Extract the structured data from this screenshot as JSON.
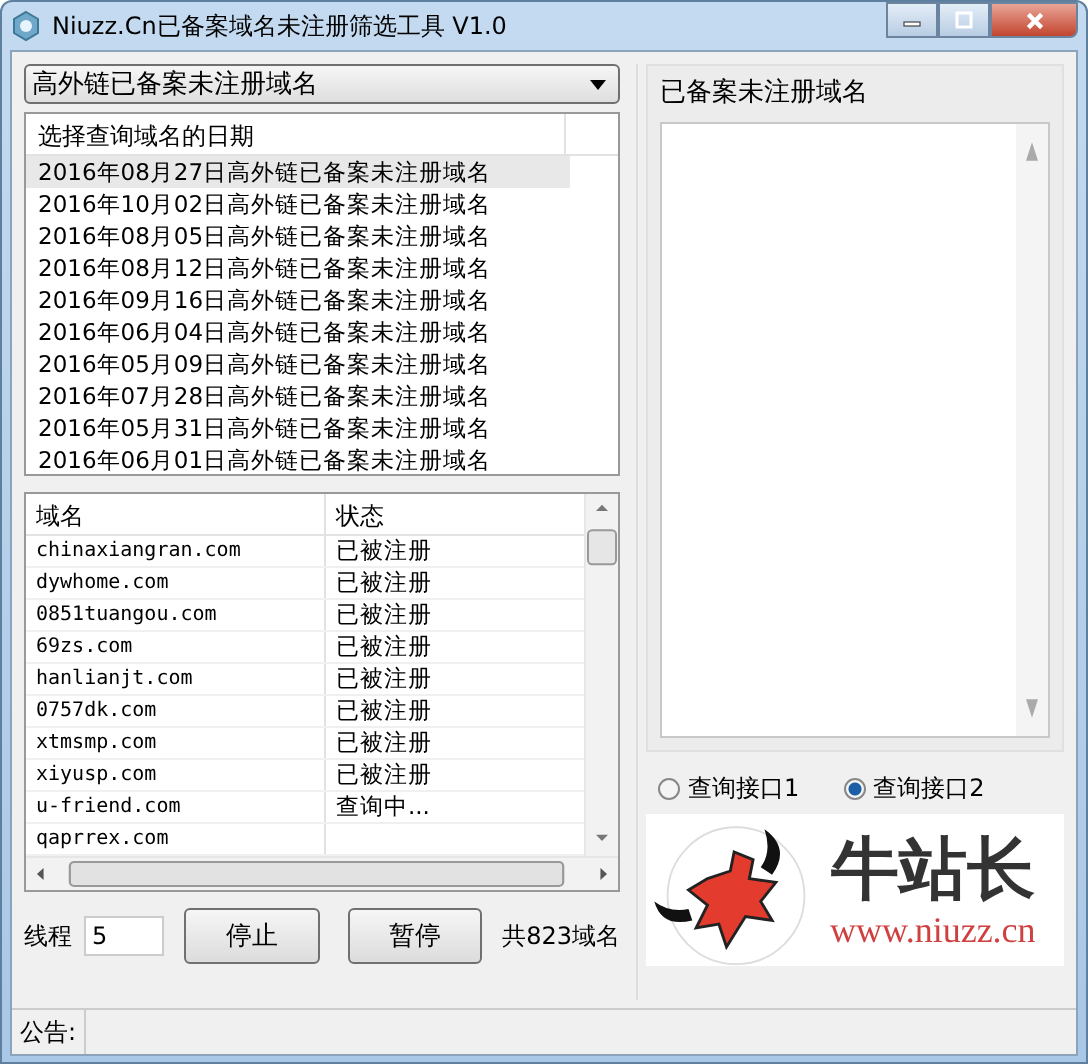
{
  "window": {
    "title": "Niuzz.Cn已备案域名未注册筛选工具 V1.0"
  },
  "category_select": {
    "value": "高外链已备案未注册域名"
  },
  "date_list": {
    "header": "选择查询域名的日期",
    "rows": [
      {
        "label": "2016年08月27日高外链已备案未注册域名",
        "selected": true
      },
      {
        "label": "2016年10月02日高外链已备案未注册域名",
        "selected": false
      },
      {
        "label": "2016年08月05日高外链已备案未注册域名",
        "selected": false
      },
      {
        "label": "2016年08月12日高外链已备案未注册域名",
        "selected": false
      },
      {
        "label": "2016年09月16日高外链已备案未注册域名",
        "selected": false
      },
      {
        "label": "2016年06月04日高外链已备案未注册域名",
        "selected": false
      },
      {
        "label": "2016年05月09日高外链已备案未注册域名",
        "selected": false
      },
      {
        "label": "2016年07月28日高外链已备案未注册域名",
        "selected": false
      },
      {
        "label": "2016年05月31日高外链已备案未注册域名",
        "selected": false
      },
      {
        "label": "2016年06月01日高外链已备案未注册域名",
        "selected": false
      }
    ]
  },
  "domain_table": {
    "columns": [
      "域名",
      "状态"
    ],
    "rows": [
      {
        "domain": "chinaxiangran.com",
        "status": "已被注册"
      },
      {
        "domain": "dywhome.com",
        "status": "已被注册"
      },
      {
        "domain": "0851tuangou.com",
        "status": "已被注册"
      },
      {
        "domain": "69zs.com",
        "status": "已被注册"
      },
      {
        "domain": "hanlianjt.com",
        "status": "已被注册"
      },
      {
        "domain": "0757dk.com",
        "status": "已被注册"
      },
      {
        "domain": "xtmsmp.com",
        "status": "已被注册"
      },
      {
        "domain": "xiyusp.com",
        "status": "已被注册"
      },
      {
        "domain": "u-friend.com",
        "status": "查询中..."
      },
      {
        "domain": "qaprrex.com",
        "status": ""
      }
    ]
  },
  "threads": {
    "label": "线程",
    "value": "5"
  },
  "buttons": [
    "停止",
    "暂停"
  ],
  "total": "共823域名",
  "result_panel": {
    "label": "已备案未注册域名"
  },
  "query_apis": [
    {
      "label": "查询接口1",
      "selected": false
    },
    {
      "label": "查询接口2",
      "selected": true
    }
  ],
  "logo": {
    "name": "牛站长",
    "url": "www.niuzz.cn"
  },
  "status_bar": {
    "label": "公告:"
  }
}
